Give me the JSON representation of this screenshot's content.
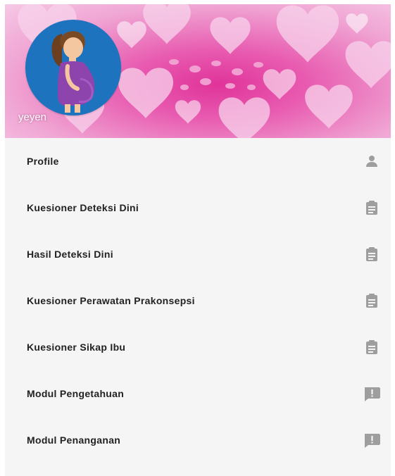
{
  "header": {
    "username": "yeyen",
    "colors": {
      "primary": "#e0339a",
      "avatar_bg": "#1e73be",
      "dress": "#8e44ad"
    },
    "avatar_icon": "pregnant-woman-icon"
  },
  "menu": {
    "items": [
      {
        "label": "Profile",
        "icon": "person-icon"
      },
      {
        "label": "Kuesioner Deteksi Dini",
        "icon": "clipboard-icon"
      },
      {
        "label": "Hasil Deteksi Dini",
        "icon": "clipboard-icon"
      },
      {
        "label": "Kuesioner Perawatan Prakonsepsi",
        "icon": "clipboard-icon"
      },
      {
        "label": "Kuesioner Sikap Ibu",
        "icon": "clipboard-icon"
      },
      {
        "label": "Modul Pengetahuan",
        "icon": "feedback-icon"
      },
      {
        "label": "Modul Penanganan",
        "icon": "feedback-icon"
      }
    ]
  }
}
